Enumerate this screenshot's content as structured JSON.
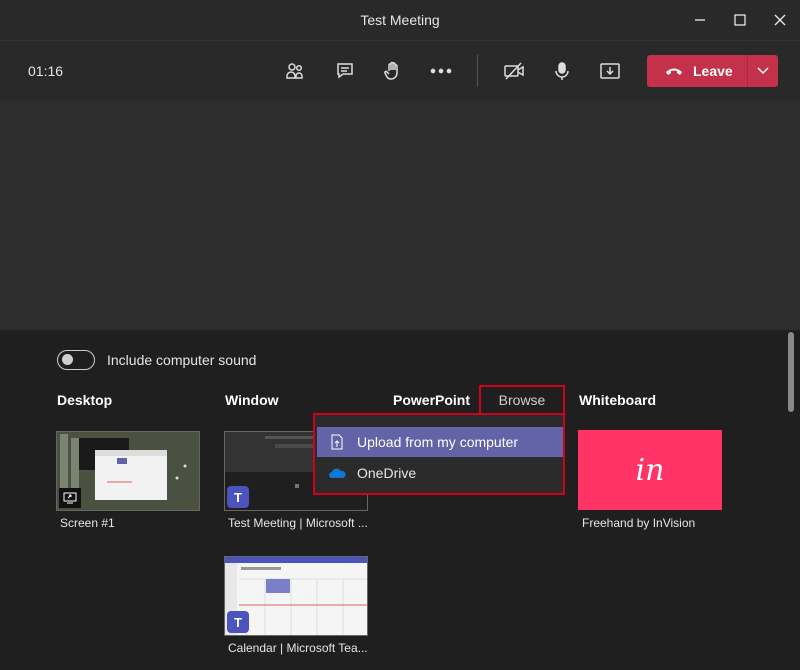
{
  "window": {
    "title": "Test Meeting",
    "controls": [
      "minimize-icon",
      "maximize-icon",
      "close-icon"
    ]
  },
  "toolbar": {
    "timer": "01:16",
    "buttons": [
      "participants-icon",
      "chat-icon",
      "raise-hand-icon",
      "more-icon",
      "camera-off-icon",
      "mic-icon",
      "share-tray-icon"
    ],
    "leave_label": "Leave",
    "leave_color": "#c4314b"
  },
  "share": {
    "toggle_label": "Include computer sound",
    "sections": {
      "desktop": "Desktop",
      "window": "Window",
      "powerpoint": "PowerPoint",
      "browse": "Browse",
      "whiteboard": "Whiteboard"
    },
    "desktop_items": [
      {
        "label": "Screen #1"
      }
    ],
    "window_items": [
      {
        "label": "Test Meeting | Microsoft ..."
      },
      {
        "label": "Calendar | Microsoft Tea..."
      }
    ],
    "whiteboard_items": [
      {
        "label": "Freehand by InVision",
        "logo_text": "in",
        "color": "#ff3366"
      }
    ],
    "browse_menu": [
      {
        "label": "Upload from my computer",
        "icon": "upload-file-icon",
        "selected": true
      },
      {
        "label": "OneDrive",
        "icon": "onedrive-icon",
        "selected": false
      }
    ],
    "accent": "#6264a7",
    "highlight_color": "#d0021b"
  }
}
